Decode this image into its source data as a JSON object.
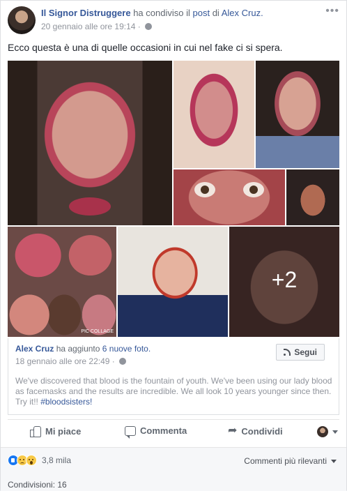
{
  "post": {
    "author": "Il Signor Distruggere",
    "action_text": "ha condiviso il",
    "post_link": "post",
    "preposition": "di",
    "original_author": "Alex Cruz.",
    "timestamp": "20 gennaio alle ore 19:14 ·",
    "more": "•••",
    "caption": "Ecco questa è una di quelle occasioni in cui nel fake ci si spera."
  },
  "photos": {
    "more_count": "+2",
    "collage_tag": "PIC COLLAGE"
  },
  "shared": {
    "author": "Alex Cruz",
    "action_text": "ha aggiunto",
    "photos_link": "6 nuove foto.",
    "timestamp": "18 gennaio alle ore 22:49 ·",
    "follow_label": "Segui",
    "text": "We've discovered that blood is the fountain of youth. We've been using our lady blood as facemasks and the results are incredible. We all look 10 years younger since then. Try it!!",
    "hashtag": "#bloodsisters!"
  },
  "actions": {
    "like": "Mi piace",
    "comment": "Commenta",
    "share": "Condividi"
  },
  "footer": {
    "reaction_count": "3,8 mila",
    "comment_sort": "Commenti più rilevanti",
    "shares": "Condivisioni: 16"
  },
  "icons": {
    "reactions": [
      "like-icon",
      "sad-icon",
      "wow-icon"
    ],
    "action_icons": [
      "thumbs-up-icon",
      "comment-icon",
      "share-arrow-icon"
    ]
  },
  "colors": {
    "link": "#365899",
    "muted": "#90949c",
    "like_blue": "#1877f2"
  }
}
